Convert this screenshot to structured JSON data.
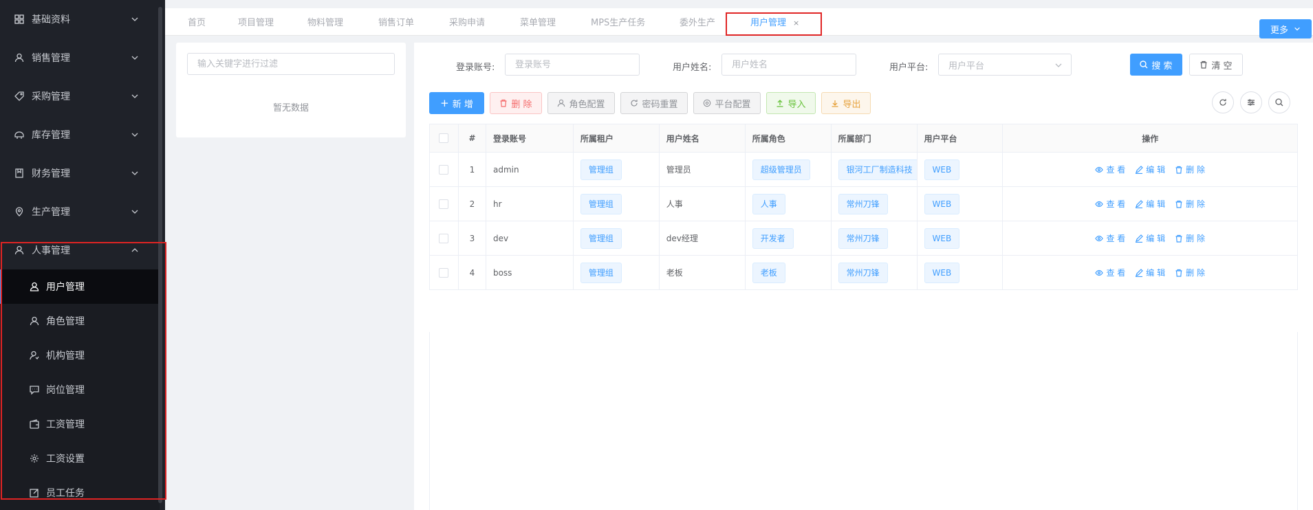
{
  "sidebar": {
    "menus": [
      {
        "label": "基础资料",
        "icon": "grid-icon"
      },
      {
        "label": "销售管理",
        "icon": "user-icon"
      },
      {
        "label": "采购管理",
        "icon": "tag-icon"
      },
      {
        "label": "库存管理",
        "icon": "box-icon"
      },
      {
        "label": "财务管理",
        "icon": "notebook-icon"
      },
      {
        "label": "生产管理",
        "icon": "location-icon"
      },
      {
        "label": "人事管理",
        "icon": "user-icon"
      }
    ],
    "sub_items": [
      {
        "label": "用户管理",
        "icon": "user-icon"
      },
      {
        "label": "角色管理",
        "icon": "user-icon"
      },
      {
        "label": "机构管理",
        "icon": "user-icon"
      },
      {
        "label": "岗位管理",
        "icon": "chat-icon"
      },
      {
        "label": "工资管理",
        "icon": "wallet-icon"
      },
      {
        "label": "工资设置",
        "icon": "gear-icon"
      },
      {
        "label": "员工任务",
        "icon": "edit-icon"
      }
    ]
  },
  "tabs": [
    {
      "label": "首页"
    },
    {
      "label": "项目管理"
    },
    {
      "label": "物料管理"
    },
    {
      "label": "销售订单"
    },
    {
      "label": "采购申请"
    },
    {
      "label": "菜单管理"
    },
    {
      "label": "MPS生产任务"
    },
    {
      "label": "委外生产"
    },
    {
      "label": "用户管理",
      "close": "×"
    }
  ],
  "more_label": "更多",
  "left_panel": {
    "filter_placeholder": "输入关键字进行过滤",
    "empty_text": "暂无数据"
  },
  "search": {
    "account_label": "登录账号:",
    "account_placeholder": "登录账号",
    "name_label": "用户姓名:",
    "name_placeholder": "用户姓名",
    "platform_label": "用户平台:",
    "platform_placeholder": "用户平台",
    "search_button": "搜 索",
    "clear_button": "清 空"
  },
  "toolbar": {
    "add": "新 增",
    "delete": "删 除",
    "role_config": "角色配置",
    "reset_password": "密码重置",
    "platform_config": "平台配置",
    "import": "导入",
    "export": "导出"
  },
  "table": {
    "headers": [
      "#",
      "登录账号",
      "所属租户",
      "用户姓名",
      "所属角色",
      "所属部门",
      "用户平台",
      "操作"
    ],
    "rows": [
      {
        "index": "1",
        "account": "admin",
        "tenant": "管理组",
        "name": "管理员",
        "role": "超级管理员",
        "dept": "银河工厂制造科技",
        "platform": "WEB"
      },
      {
        "index": "2",
        "account": "hr",
        "tenant": "管理组",
        "name": "人事",
        "role": "人事",
        "dept": "常州刀锋",
        "platform": "WEB"
      },
      {
        "index": "3",
        "account": "dev",
        "tenant": "管理组",
        "name": "dev经理",
        "role": "开发者",
        "dept": "常州刀锋",
        "platform": "WEB"
      },
      {
        "index": "4",
        "account": "boss",
        "tenant": "管理组",
        "name": "老板",
        "role": "老板",
        "dept": "常州刀锋",
        "platform": "WEB"
      }
    ],
    "ops": {
      "view": "查 看",
      "edit": "编 辑",
      "delete": "删 除"
    }
  }
}
